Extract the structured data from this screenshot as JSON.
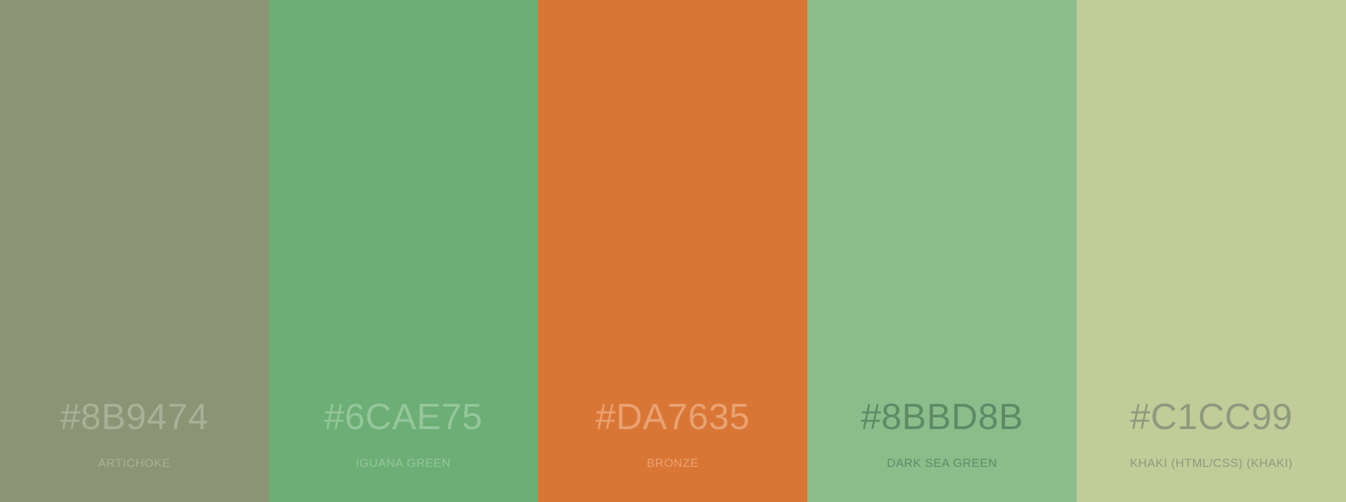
{
  "palette": {
    "swatches": [
      {
        "hex_label": "#8B9474",
        "name": "ARTICHOKE",
        "color": "#8B9474",
        "text_color": "#A9B097"
      },
      {
        "hex_label": "#6CAE75",
        "name": "IGUANA GREEN",
        "color": "#6CAE75",
        "text_color": "#95C69B"
      },
      {
        "hex_label": "#DA7635",
        "name": "BRONZE",
        "color": "#DA7635",
        "text_color": "#E8A274"
      },
      {
        "hex_label": "#8BBD8B",
        "name": "DARK SEA GREEN",
        "color": "#8BBD8B",
        "text_color": "#5E8A66"
      },
      {
        "hex_label": "#C1CC99",
        "name": "KHAKI (HTML/CSS) (KHAKI)",
        "color": "#C1CC99",
        "text_color": "#8E9A7E"
      }
    ]
  }
}
